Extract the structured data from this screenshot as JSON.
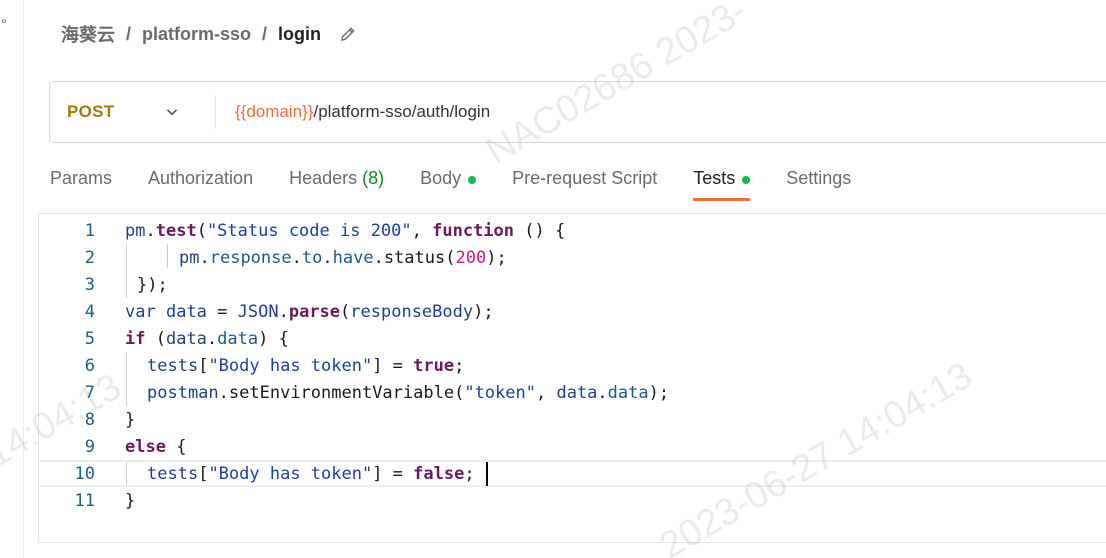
{
  "breadcrumb": {
    "workspace": "海葵云",
    "collection": "platform-sso",
    "request": "login",
    "separator": "/"
  },
  "request": {
    "method": "POST",
    "url_variable": "{{domain}}",
    "url_path": "/platform-sso/auth/login"
  },
  "tabs": [
    {
      "label": "Params"
    },
    {
      "label": "Authorization"
    },
    {
      "label": "Headers",
      "count": "(8)"
    },
    {
      "label": "Body",
      "indicator": true
    },
    {
      "label": "Pre-request Script"
    },
    {
      "label": "Tests",
      "indicator": true,
      "active": true
    },
    {
      "label": "Settings"
    }
  ],
  "editor": {
    "current_line": 10,
    "lines": [
      {
        "n": "1",
        "tokens": [
          [
            "pm",
            "var"
          ],
          [
            ".",
            "plain"
          ],
          [
            "test",
            "fn"
          ],
          [
            "(",
            "plain"
          ],
          [
            "\"Status code is 200\"",
            "str"
          ],
          [
            ", ",
            "plain"
          ],
          [
            "function",
            "kw"
          ],
          [
            " () {",
            "plain"
          ]
        ]
      },
      {
        "n": "2",
        "tokens": [
          [
            "pm",
            "var"
          ],
          [
            ".",
            "plain"
          ],
          [
            "response",
            "prop"
          ],
          [
            ".",
            "plain"
          ],
          [
            "to",
            "prop"
          ],
          [
            ".",
            "plain"
          ],
          [
            "have",
            "prop"
          ],
          [
            ".",
            "plain"
          ],
          [
            "status",
            "plain"
          ],
          [
            "(",
            "plain"
          ],
          [
            "200",
            "num"
          ],
          [
            ");",
            "plain"
          ]
        ]
      },
      {
        "n": "3",
        "tokens": [
          [
            "});",
            "plain"
          ]
        ]
      },
      {
        "n": "4",
        "tokens": [
          [
            "var",
            "var"
          ],
          [
            " ",
            "plain"
          ],
          [
            "data",
            "var"
          ],
          [
            " = ",
            "plain"
          ],
          [
            "JSON",
            "var"
          ],
          [
            ".",
            "plain"
          ],
          [
            "parse",
            "fn"
          ],
          [
            "(",
            "plain"
          ],
          [
            "responseBody",
            "var"
          ],
          [
            ");",
            "plain"
          ]
        ]
      },
      {
        "n": "5",
        "tokens": [
          [
            "if",
            "kw"
          ],
          [
            " (",
            "plain"
          ],
          [
            "data",
            "var"
          ],
          [
            ".",
            "plain"
          ],
          [
            "data",
            "prop"
          ],
          [
            ") {",
            "plain"
          ]
        ]
      },
      {
        "n": "6",
        "tokens": [
          [
            "tests",
            "var"
          ],
          [
            "[",
            "plain"
          ],
          [
            "\"Body has token\"",
            "str"
          ],
          [
            "] = ",
            "plain"
          ],
          [
            "true",
            "kw"
          ],
          [
            ";",
            "plain"
          ]
        ]
      },
      {
        "n": "7",
        "tokens": [
          [
            "postman",
            "var"
          ],
          [
            ".",
            "plain"
          ],
          [
            "setEnvironmentVariable",
            "plain"
          ],
          [
            "(",
            "plain"
          ],
          [
            "\"token\"",
            "str"
          ],
          [
            ", ",
            "plain"
          ],
          [
            "data",
            "var"
          ],
          [
            ".",
            "plain"
          ],
          [
            "data",
            "prop"
          ],
          [
            ");",
            "plain"
          ]
        ]
      },
      {
        "n": "8",
        "tokens": [
          [
            "}",
            "plain"
          ]
        ]
      },
      {
        "n": "9",
        "tokens": [
          [
            "else",
            "kw"
          ],
          [
            " ",
            "plain"
          ],
          [
            "{",
            "plain"
          ]
        ]
      },
      {
        "n": "10",
        "tokens": [
          [
            "tests",
            "var"
          ],
          [
            "[",
            "plain"
          ],
          [
            "\"Body has token\"",
            "str"
          ],
          [
            "] = ",
            "plain"
          ],
          [
            "false",
            "kw"
          ],
          [
            ";",
            "plain"
          ],
          [
            " ",
            "plain"
          ]
        ]
      },
      {
        "n": "11",
        "tokens": [
          [
            "}",
            "plain"
          ]
        ]
      }
    ]
  },
  "watermark": {
    "top": "NAC02686  2023-",
    "left": "14:04:13",
    "bottom": "2023-06-27   14:04:13"
  },
  "colors": {
    "accent": "#f26b3a",
    "method": "#a07c00",
    "indicator": "#0cbb52"
  },
  "icons": {
    "edit": "pencil-icon",
    "method_dropdown": "chevron-down-icon"
  }
}
